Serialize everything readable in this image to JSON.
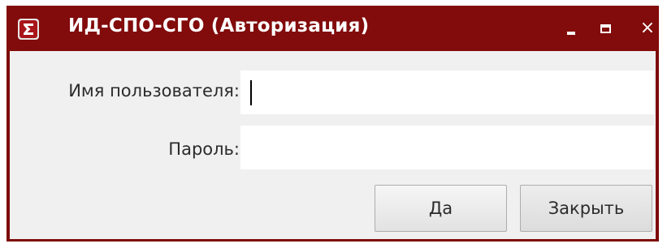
{
  "window": {
    "title": "ИД-СПО-СГО (Авторизация)",
    "app_icon": "sigma-icon",
    "controls": {
      "minimize": "minimize-icon",
      "maximize": "maximize-icon",
      "close": "×"
    }
  },
  "form": {
    "username_label": "Имя пользователя:",
    "username_value": "",
    "password_label": "Пароль:",
    "password_value": ""
  },
  "buttons": {
    "ok_label": "Да",
    "close_label": "Закрыть"
  },
  "colors": {
    "titlebar": "#820b0b",
    "client_bg": "#f0f0f0"
  }
}
